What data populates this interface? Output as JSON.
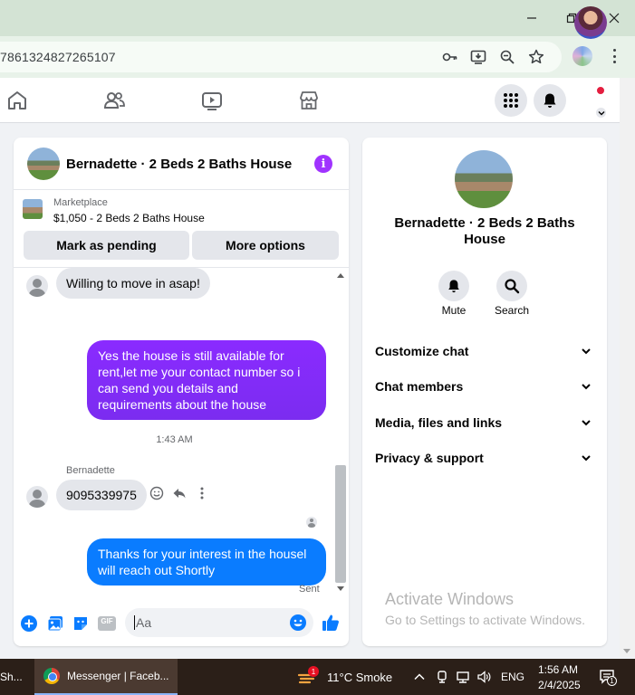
{
  "browser": {
    "url": "7861324827265107"
  },
  "chat": {
    "title": "Bernadette · 2 Beds 2 Baths House",
    "info_icon": "i",
    "listing": {
      "label": "Marketplace",
      "price_title": "$1,050 - 2 Beds 2 Baths House"
    },
    "buttons": {
      "mark_pending": "Mark as pending",
      "more_options": "More options"
    },
    "messages": [
      {
        "from": "them",
        "text": "Willing to move in asap!"
      },
      {
        "from": "me",
        "text": "Yes the house is still available for rent,let me your contact number so i can send you details and requirements about the house"
      },
      {
        "timestamp": "1:43 AM"
      },
      {
        "from": "them",
        "sender": "Bernadette",
        "text": "9095339975"
      },
      {
        "from": "me",
        "text": "Thanks for your interest in the housel will reach out Shortly"
      }
    ],
    "time": "1:43 AM",
    "sender_name": "Bernadette",
    "sent_label": "Sent",
    "composer": {
      "placeholder": "Aa",
      "gif_label": "GIF"
    },
    "colors": {
      "outgoing_purple": "#8a2bff",
      "outgoing_blue": "#0a7cff",
      "accent": "#a033ff"
    }
  },
  "info_panel": {
    "name": "Bernadette · 2 Beds 2 Baths House",
    "actions": [
      {
        "label": "Mute",
        "icon": "bell-icon"
      },
      {
        "label": "Search",
        "icon": "search-icon"
      }
    ],
    "menu": [
      {
        "label": "Customize chat"
      },
      {
        "label": "Chat members"
      },
      {
        "label": "Media, files and links"
      },
      {
        "label": "Privacy & support"
      }
    ]
  },
  "watermark": {
    "line1": "Activate Windows",
    "line2": "Go to Settings to activate Windows."
  },
  "taskbar": {
    "left_item": "Sh...",
    "active_app": "Messenger | Faceb...",
    "weather_badge": "1",
    "weather": "11°C  Smoke",
    "language": "ENG",
    "time": "1:56 AM",
    "date": "2/4/2025",
    "notification_count": "1"
  }
}
